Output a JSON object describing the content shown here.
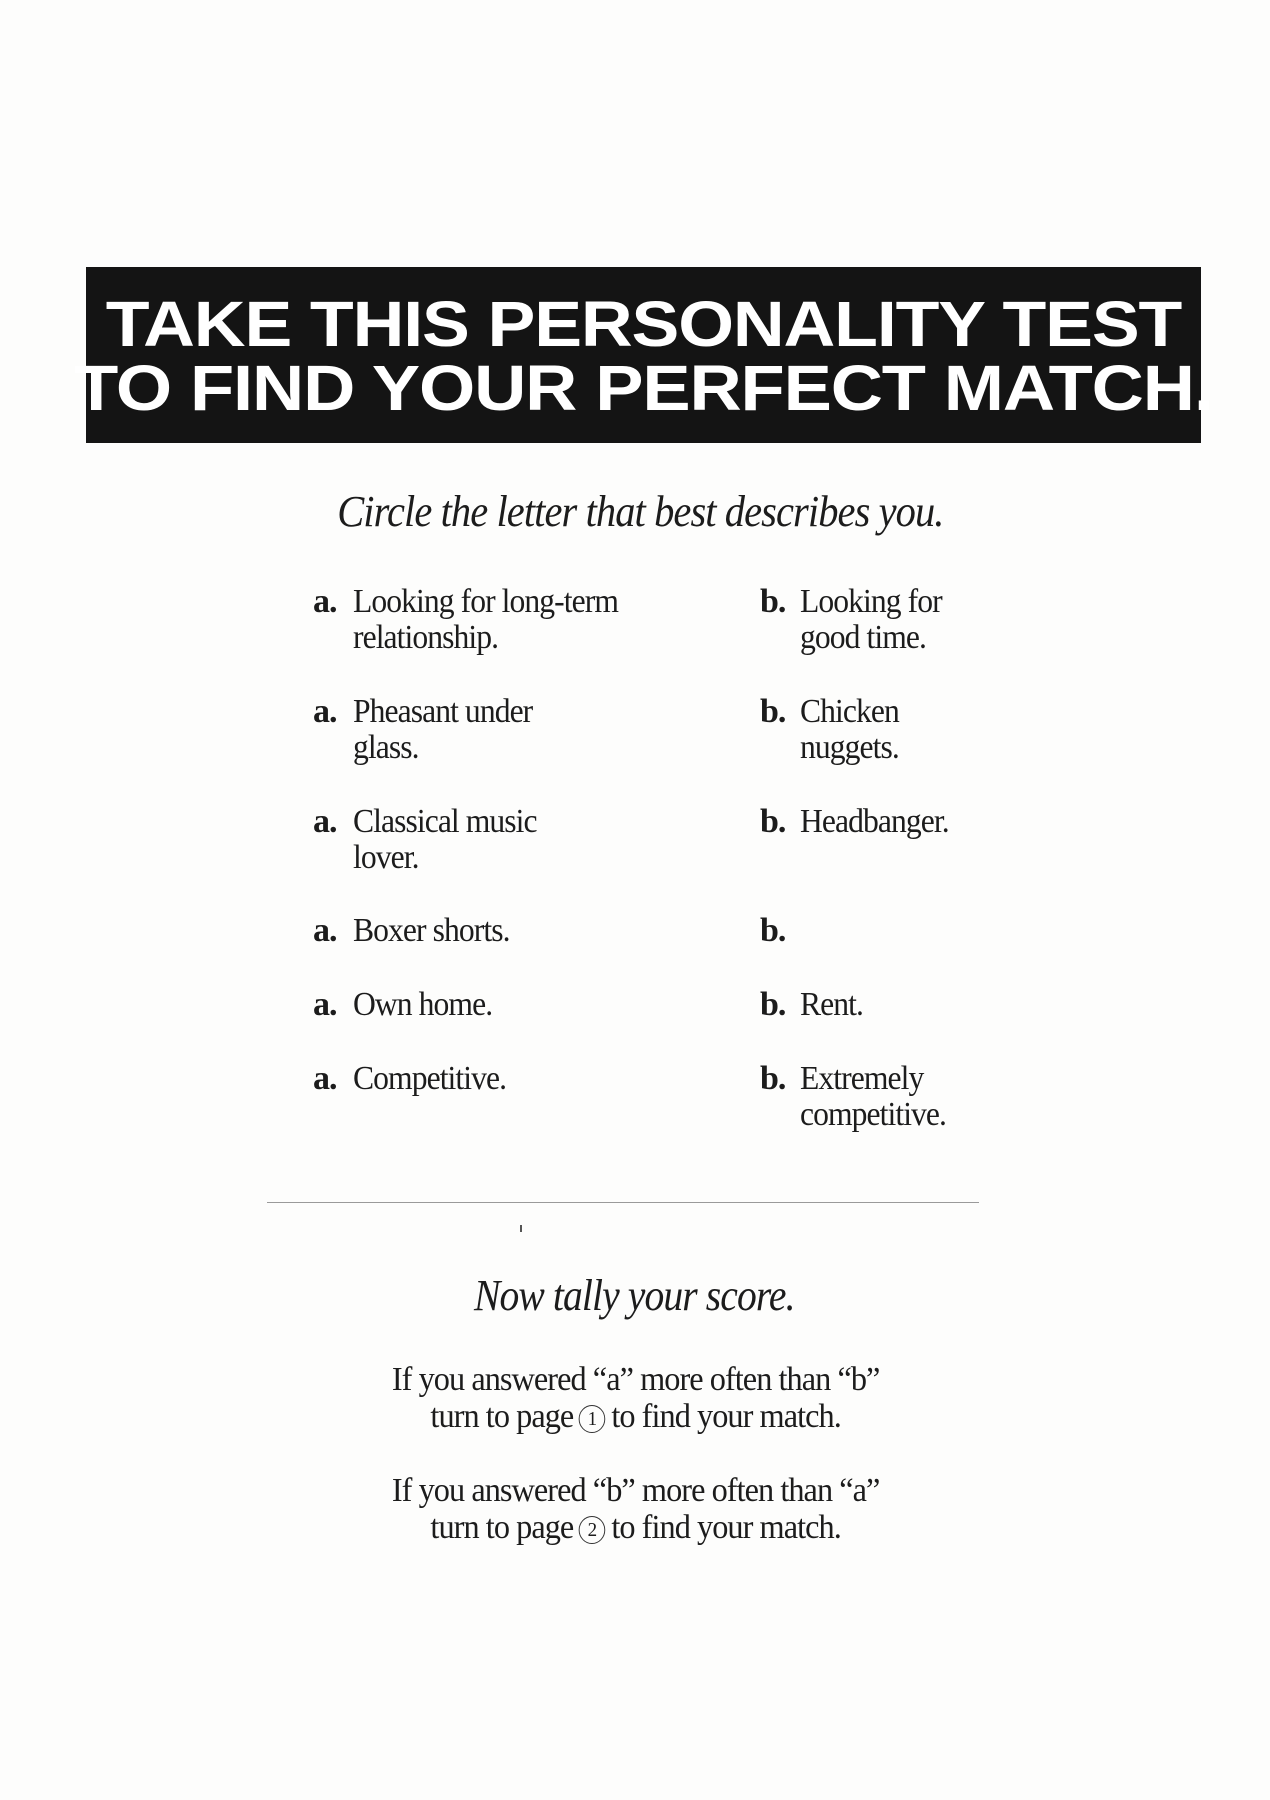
{
  "headline": {
    "line1": "TAKE THIS PERSONALITY TEST",
    "line2": "TO FIND YOUR PERFECT MATCH."
  },
  "instruction": "Circle the letter that best describes you.",
  "questions": [
    {
      "a_letter": "a.",
      "a_text": "Looking for long-term\nrelationship.",
      "b_letter": "b.",
      "b_text": "Looking for\ngood time."
    },
    {
      "a_letter": "a.",
      "a_text": "Pheasant under\nglass.",
      "b_letter": "b.",
      "b_text": "Chicken\nnuggets."
    },
    {
      "a_letter": "a.",
      "a_text": "Classical music\nlover.",
      "b_letter": "b.",
      "b_text": "Headbanger."
    },
    {
      "a_letter": "a.",
      "a_text": "Boxer shorts.",
      "b_letter": "b.",
      "b_text": ""
    },
    {
      "a_letter": "a.",
      "a_text": "Own home.",
      "b_letter": "b.",
      "b_text": "Rent."
    },
    {
      "a_letter": "a.",
      "a_text": "Competitive.",
      "b_letter": "b.",
      "b_text": "Extremely\ncompetitive."
    }
  ],
  "tally": {
    "heading": "Now tally your score.",
    "result_a": {
      "line1": "If you answered “a” more often than “b”",
      "prefix": "turn to page",
      "page": "1",
      "suffix": "to find your match."
    },
    "result_b": {
      "line1": "If you answered “b” more often than “a”",
      "prefix": "turn to page",
      "page": "2",
      "suffix": "to find your match."
    }
  }
}
